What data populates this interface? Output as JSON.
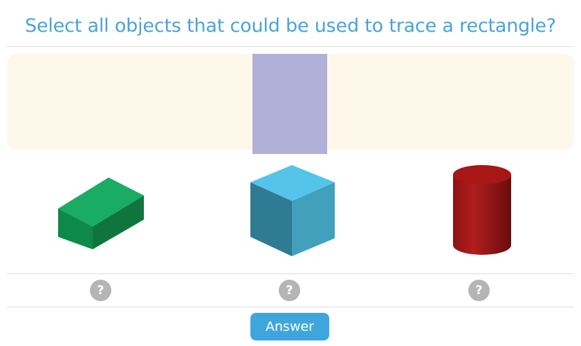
{
  "question": "Select all objects that could be used to trace a rectangle?",
  "target_shape": {
    "name": "rectangle",
    "color": "#b0b1d8"
  },
  "objects": [
    {
      "name": "rectangular prism",
      "icon": "green-box",
      "color": "#17a55f"
    },
    {
      "name": "cube",
      "icon": "blue-cube",
      "color": "#4fc0e8"
    },
    {
      "name": "cylinder",
      "icon": "red-cylinder",
      "color": "#a01818"
    }
  ],
  "help_icons": [
    "?",
    "?",
    "?"
  ],
  "answer_button": {
    "label": "Answer",
    "color": "#3fa6dd"
  },
  "colors": {
    "title": "#4aa3d8",
    "drop_area": "#fef8ea",
    "help_icon": "#b5b5b5"
  }
}
